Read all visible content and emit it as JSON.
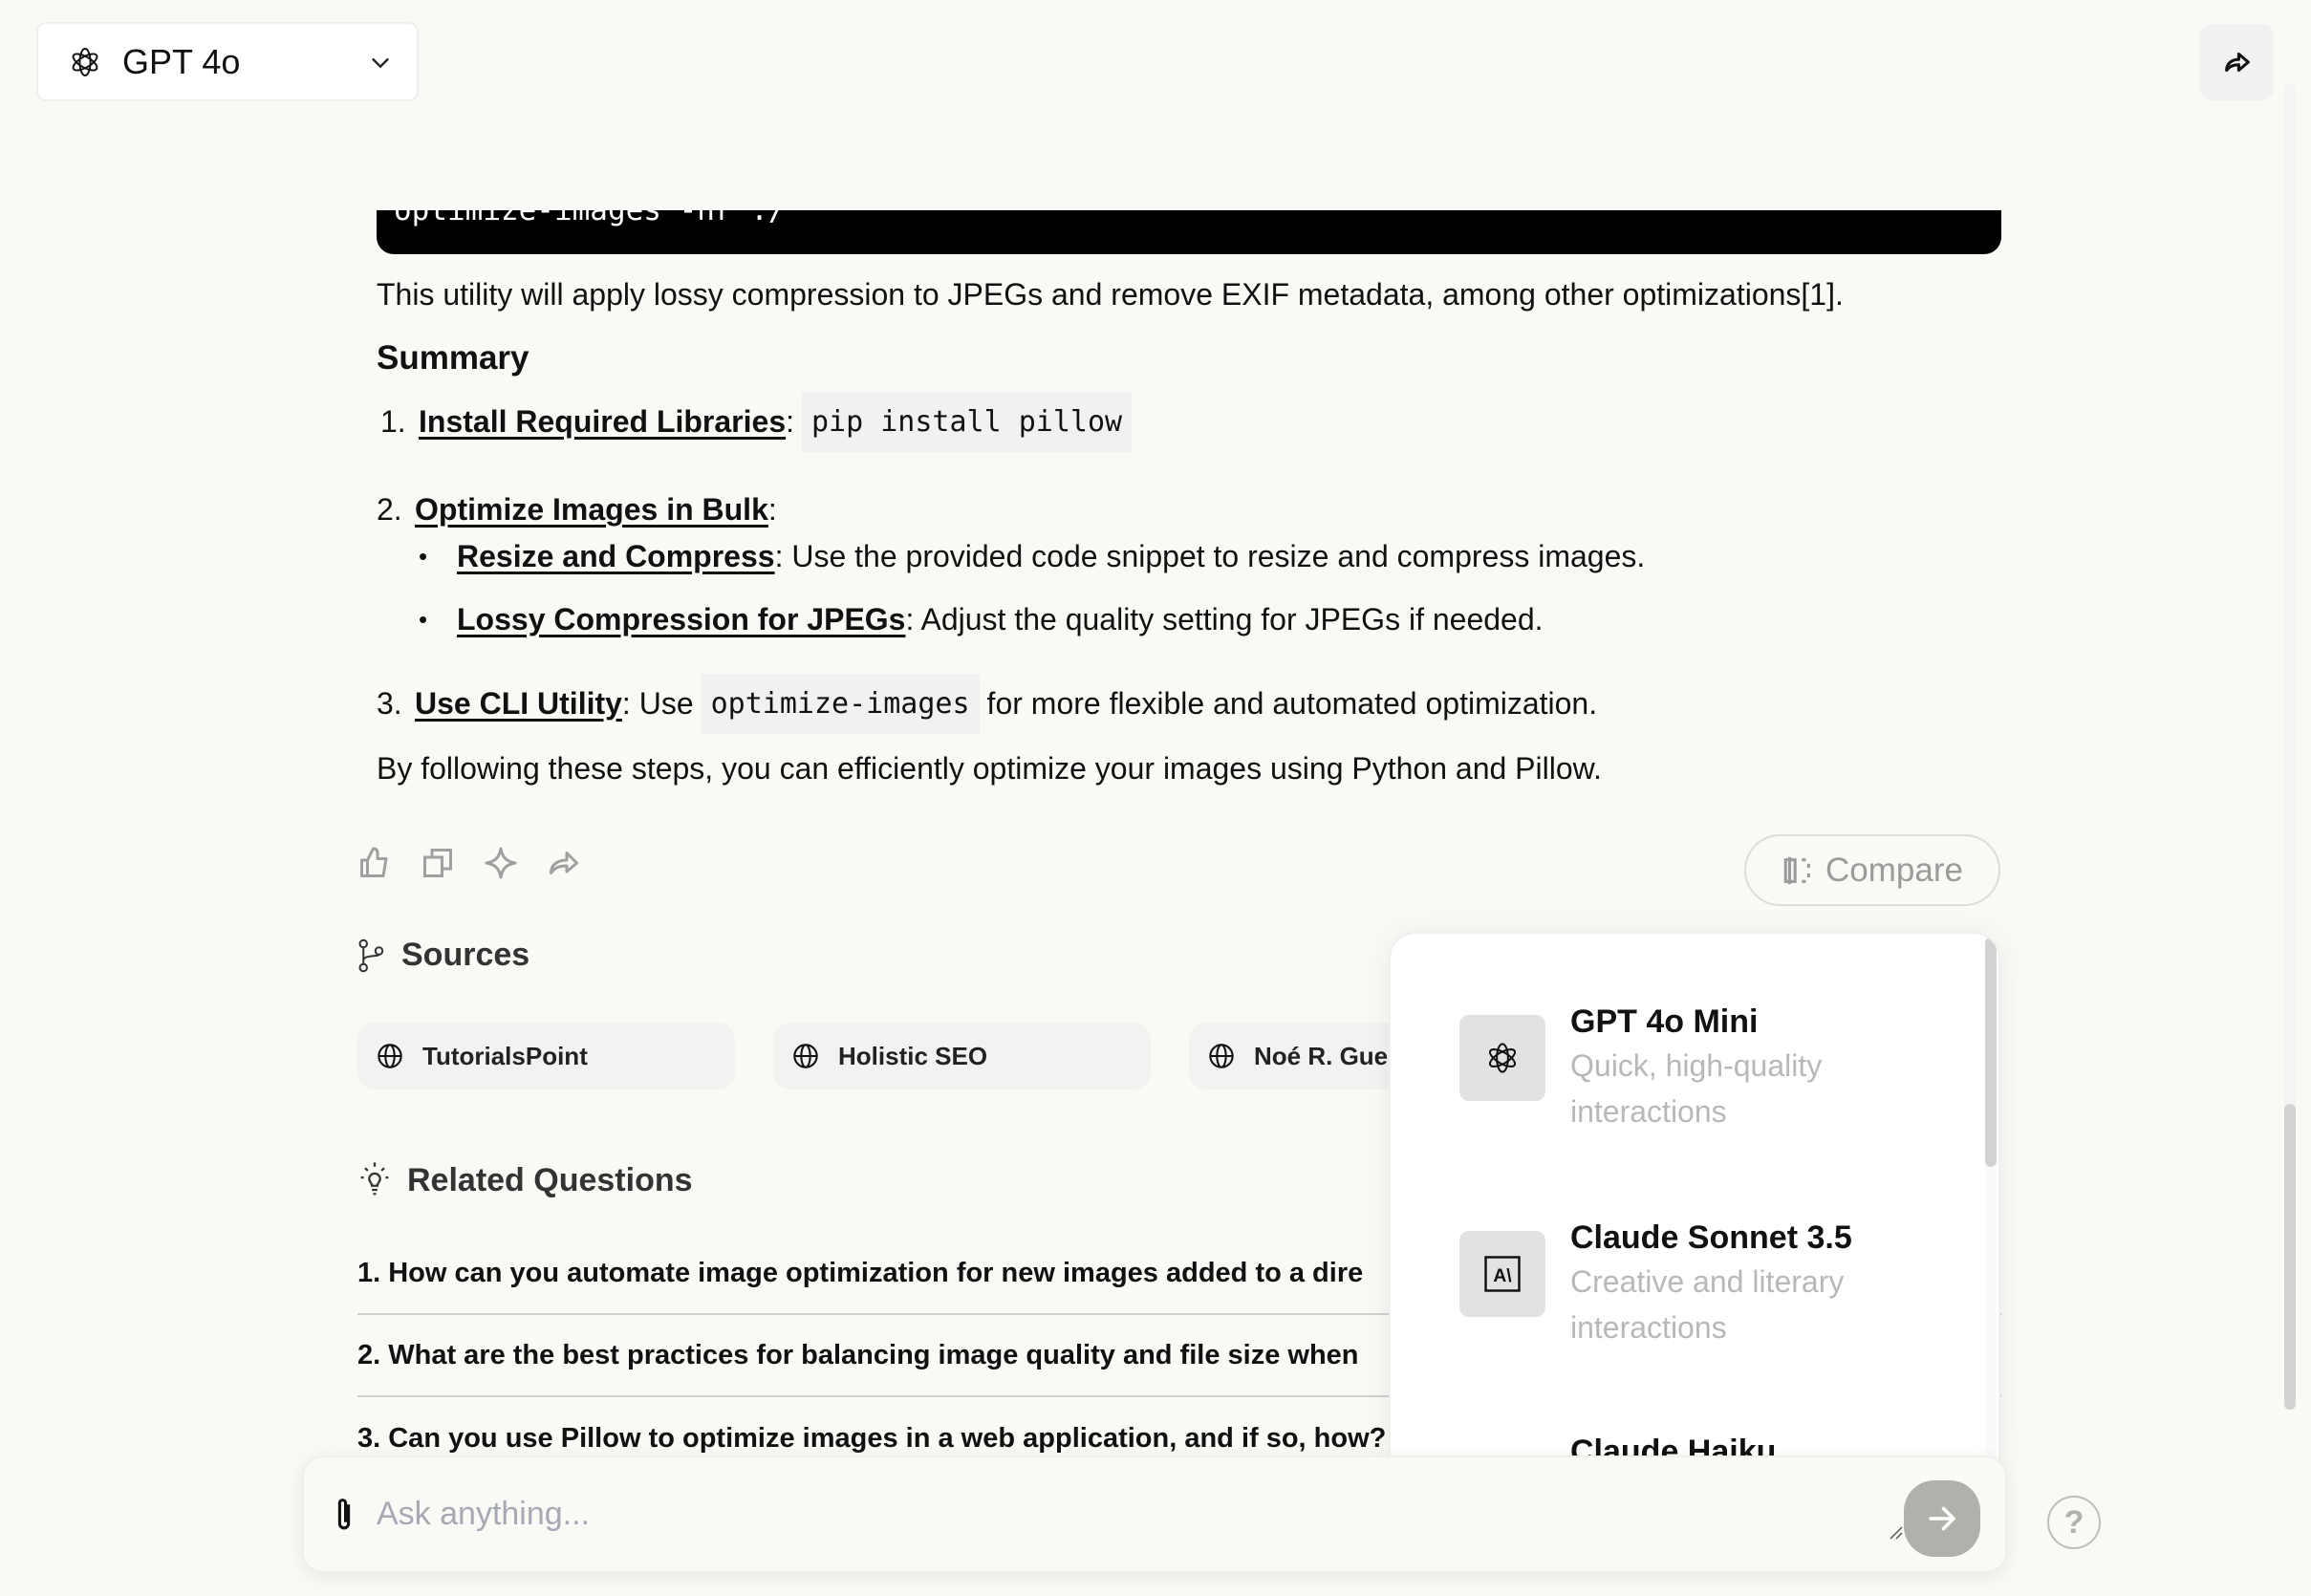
{
  "header": {
    "model_name": "GPT 4o",
    "model_icon": "openai-logo-icon",
    "share_icon": "share-icon"
  },
  "answer": {
    "code_line": "optimize-images -nr ./",
    "paragraph_1": "This utility will apply lossy compression to JPEGs and remove EXIF metadata, among other optimizations[1].",
    "summary_heading": "Summary",
    "summary_items": [
      {
        "num": "1.",
        "link": "Install Required Libraries",
        "sep": ":",
        "code": "pip install pillow",
        "text": ""
      },
      {
        "num": "2.",
        "link": "Optimize Images in Bulk",
        "sep": ":",
        "code": "",
        "text": ""
      },
      {
        "num": "3.",
        "link": "Use CLI Utility",
        "sep": ": Use",
        "code": "optimize-images",
        "text": "for more flexible and automated optimization."
      }
    ],
    "sub_items": [
      {
        "link": "Resize and Compress",
        "text": ": Use the provided code snippet to resize and compress images."
      },
      {
        "link": "Lossy Compression for JPEGs",
        "text": ": Adjust the quality setting for JPEGs if needed."
      }
    ],
    "closing": "By following these steps, you can efficiently optimize your images using Python and Pillow."
  },
  "actions": {
    "icons": [
      "thumbs-up-icon",
      "copy-icon",
      "sparkle-icon",
      "share-icon"
    ],
    "compare_label": "Compare"
  },
  "sources": {
    "title": "Sources",
    "items": [
      {
        "label": "TutorialsPoint"
      },
      {
        "label": "Holistic SEO"
      },
      {
        "label": "Noé R. Guer"
      }
    ]
  },
  "related": {
    "title": "Related Questions",
    "items": [
      "1. How can you automate image optimization for new images added to a dire",
      "2. What are the best practices for balancing image quality and file size when",
      "3. Can you use Pillow to optimize images in a web application, and if so, how?"
    ]
  },
  "model_menu": {
    "items": [
      {
        "title": "GPT 4o Mini",
        "desc": "Quick, high-quality interactions",
        "icon": "openai-logo-icon"
      },
      {
        "title": "Claude Sonnet 3.5",
        "desc": "Creative and literary interactions",
        "icon": "anthropic-logo-icon"
      },
      {
        "title": "Claude Haiku",
        "desc": "",
        "icon": "anthropic-logo-icon"
      }
    ]
  },
  "composer": {
    "placeholder": "Ask anything...",
    "value": "",
    "help_label": "?"
  },
  "colors": {
    "background": "#f9f9f6",
    "send_button": "#b1b1ac",
    "muted_text": "#b8b8b8"
  }
}
